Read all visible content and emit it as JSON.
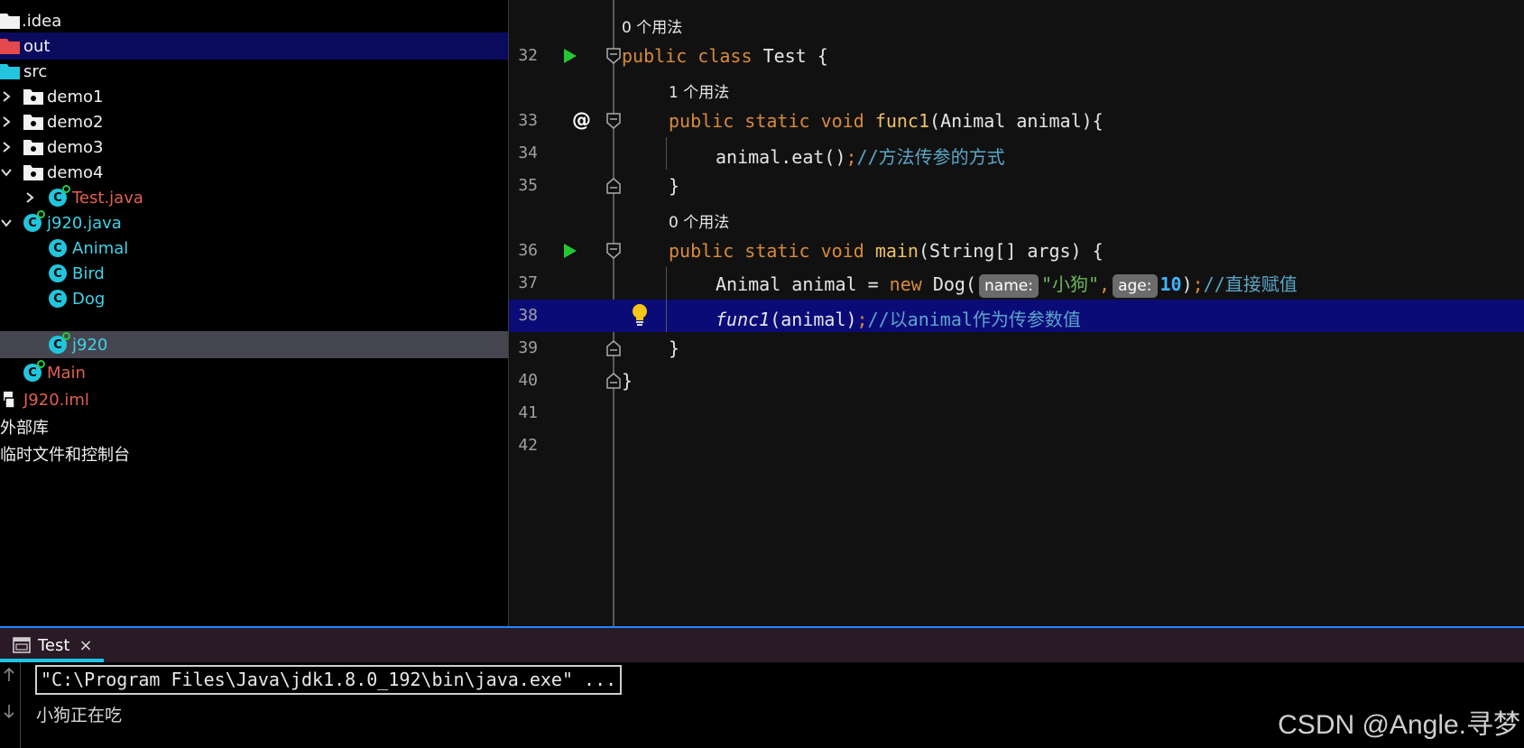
{
  "tree": {
    "items": [
      {
        "label": ".idea"
      },
      {
        "label": "out"
      },
      {
        "label": "src"
      },
      {
        "label": "demo1"
      },
      {
        "label": "demo2"
      },
      {
        "label": "demo3"
      },
      {
        "label": "demo4"
      },
      {
        "label": "Test.java"
      },
      {
        "label": "j920.java"
      },
      {
        "label": "Animal"
      },
      {
        "label": "Bird"
      },
      {
        "label": "Dog"
      },
      {
        "label": "j920"
      },
      {
        "label": "Main"
      },
      {
        "label": "J920.iml"
      },
      {
        "label": "外部库"
      },
      {
        "label": "临时文件和控制台"
      }
    ]
  },
  "editor": {
    "usages": {
      "u1": "0 个用法",
      "u2": "1 个用法",
      "u3": "0 个用法"
    },
    "line_numbers": [
      "32",
      "33",
      "34",
      "35",
      "36",
      "37",
      "38",
      "39",
      "40",
      "41",
      "42"
    ],
    "tokens": {
      "public": "public",
      "class": "class",
      "static": "static",
      "void": "void",
      "new": "new",
      "test_name": "Test",
      "brace_open": " {",
      "func1": "func1",
      "func1_params": "(Animal animal){",
      "eat_call": "animal.eat()",
      "semi": ";",
      "comment34": "//方法传参的方式",
      "close_brace": "}",
      "main": "main",
      "main_params": "(String[] args) {",
      "animal_decl": "Animal animal = ",
      "dog_open": "Dog(",
      "hint_name": "name:",
      "dog_str": "\"小狗\"",
      "comma": ",",
      "hint_age": "age:",
      "age_val": "10",
      "close_paren": ")",
      "comment37": "//直接赋值",
      "call_args": "(animal)",
      "comment38": "//以animal作为传参数值",
      "at_sign": "@"
    }
  },
  "run_panel": {
    "tab_label": "Test",
    "close_glyph": "×",
    "command": "\"C:\\Program Files\\Java\\jdk1.8.0_192\\bin\\java.exe\" ...",
    "output": "小狗正在吃",
    "watermark": "CSDN @Angle.寻梦"
  },
  "colors": {
    "selection": "#0b0b5e",
    "current_line": "#0b0b78",
    "class_icon": "#21c5dc",
    "keyword": "#d98a3a",
    "comment": "#5aa6c8"
  }
}
